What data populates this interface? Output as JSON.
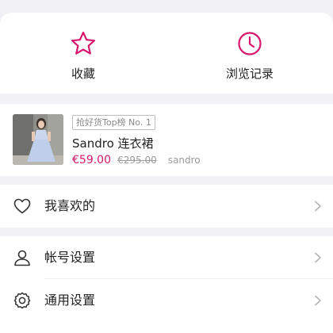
{
  "shortcuts": [
    {
      "label": "收藏",
      "icon": "star-icon"
    },
    {
      "label": "浏览记录",
      "icon": "clock-icon"
    }
  ],
  "product": {
    "badge": "抢好货Top榜 No. 1",
    "title": "Sandro 连衣裙",
    "price": "€59.00",
    "original_price": "€295.00",
    "brand": "sandro"
  },
  "menu": {
    "favorites": {
      "label": "我喜欢的",
      "icon": "heart-icon"
    },
    "account": {
      "label": "帐号设置",
      "icon": "user-icon"
    },
    "general": {
      "label": "通用设置",
      "icon": "settings-icon"
    }
  },
  "colors": {
    "accent": "#d8176d",
    "background": "#f2f1f6"
  }
}
